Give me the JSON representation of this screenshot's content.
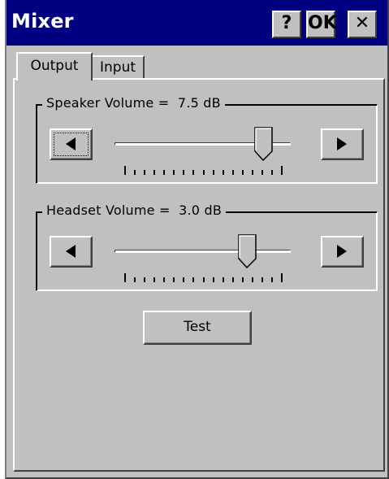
{
  "window": {
    "title": "Mixer",
    "buttons": {
      "help": "?",
      "ok": "OK",
      "close": "✕"
    }
  },
  "tabs": [
    {
      "label": "Output",
      "selected": true
    },
    {
      "label": "Input",
      "selected": false
    }
  ],
  "output": {
    "speaker": {
      "label": "Speaker Volume =  7.5 dB",
      "level": 0.88,
      "ticks": 16
    },
    "headset": {
      "label": "Headset Volume =  3.0 dB",
      "level": 0.78,
      "ticks": 16
    },
    "test_label": "Test"
  },
  "colors": {
    "titlebar": "#000080",
    "face": "#c0c0c0"
  }
}
